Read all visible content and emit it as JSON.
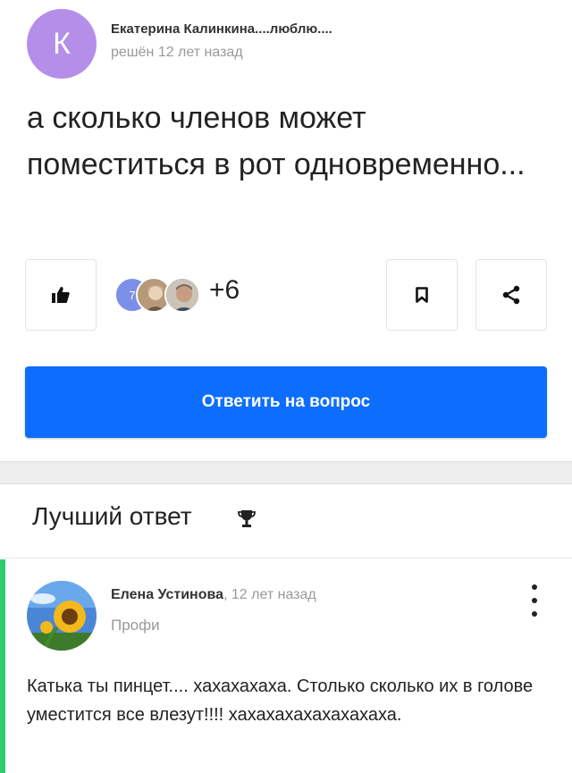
{
  "question": {
    "author_initial": "К",
    "author_name": "Екатерина Калинкина....люблю....",
    "meta": "решён 12 лет назад",
    "text": "а сколько членов может поместиться в рот одновременно...",
    "voters_first_avatar_label": "7",
    "voters_more": "+6",
    "answer_button": "Ответить на вопрос",
    "icons": {
      "like": "thumbs-up-icon",
      "bookmark": "bookmark-icon",
      "share": "share-icon"
    }
  },
  "best_answer": {
    "section_title": "Лучший ответ",
    "trophy_icon": "trophy-icon",
    "author_name": "Елена Устинова",
    "time": ", 12 лет назад",
    "badge": "Профи",
    "text": "Катька ты пинцет.... хахахахаха. Столько сколько их в голове уместится все влезут!!!! хахахахахахахахаха.",
    "accent_color": "#2ecc71"
  },
  "colors": {
    "primary": "#0d6efd",
    "avatar_k": "#b48ee8",
    "muted_text": "#999999"
  }
}
